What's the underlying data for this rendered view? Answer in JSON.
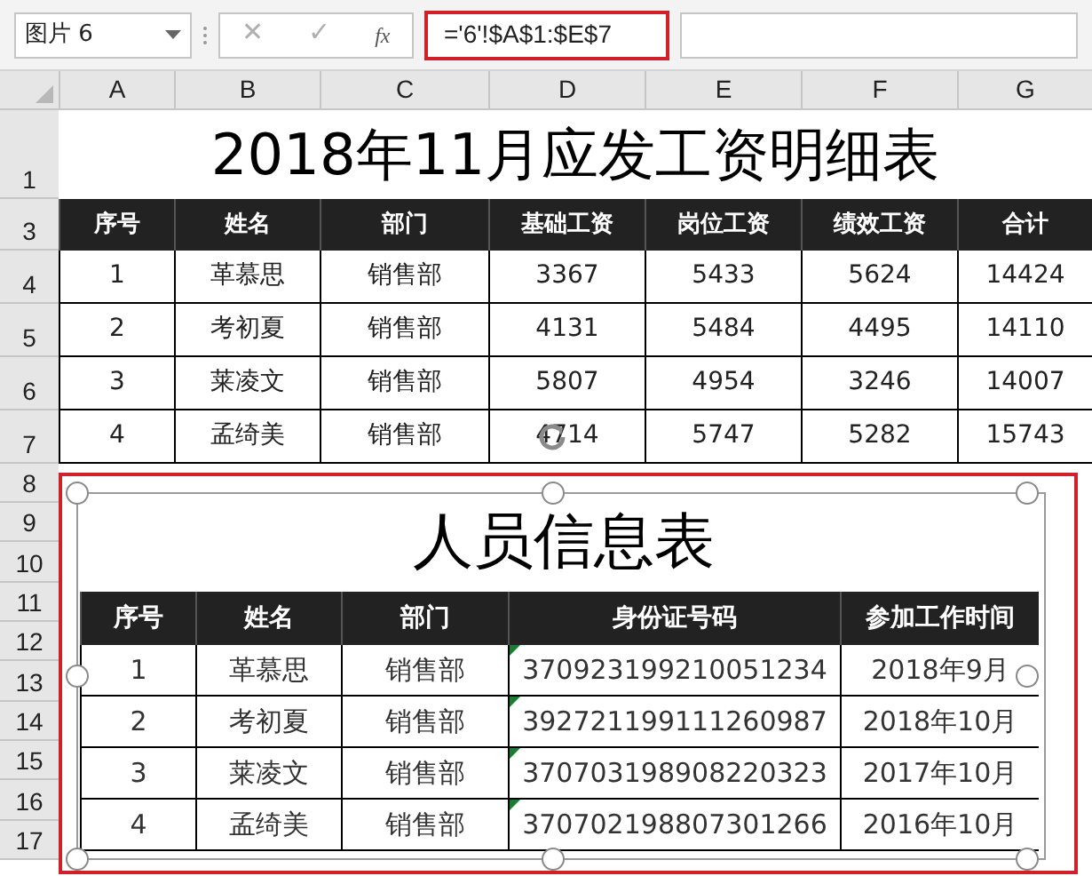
{
  "name_box": {
    "value": "图片 6"
  },
  "formula_bar": {
    "cancel": "✕",
    "enter": "✓",
    "fx": "fx",
    "formula": "='6'!$A$1:$E$7"
  },
  "column_headers": [
    "A",
    "B",
    "C",
    "D",
    "E",
    "F",
    "G"
  ],
  "row_headers": [
    "1",
    "3",
    "4",
    "5",
    "6",
    "7",
    "8",
    "9",
    "10",
    "11",
    "12",
    "13",
    "14",
    "15",
    "16",
    "17"
  ],
  "sheet": {
    "title": "2018年11月应发工资明细表",
    "headers": [
      "序号",
      "姓名",
      "部门",
      "基础工资",
      "岗位工资",
      "绩效工资",
      "合计"
    ],
    "rows": [
      [
        "1",
        "革慕思",
        "销售部",
        "3367",
        "5433",
        "5624",
        "14424"
      ],
      [
        "2",
        "考初夏",
        "销售部",
        "4131",
        "5484",
        "4495",
        "14110"
      ],
      [
        "3",
        "莱凌文",
        "销售部",
        "5807",
        "4954",
        "3246",
        "14007"
      ],
      [
        "4",
        "孟绮美",
        "销售部",
        "4714",
        "5747",
        "5282",
        "15743"
      ]
    ]
  },
  "picture": {
    "title": "人员信息表",
    "headers": [
      "序号",
      "姓名",
      "部门",
      "身份证号码",
      "参加工作时间"
    ],
    "rows": [
      [
        "1",
        "革慕思",
        "销售部",
        "370923199210051234",
        "2018年9月"
      ],
      [
        "2",
        "考初夏",
        "销售部",
        "392721199111260987",
        "2018年10月"
      ],
      [
        "3",
        "莱凌文",
        "销售部",
        "370703198908220323",
        "2017年10月"
      ],
      [
        "4",
        "孟绮美",
        "销售部",
        "370702198807301266",
        "2016年10月"
      ]
    ]
  }
}
